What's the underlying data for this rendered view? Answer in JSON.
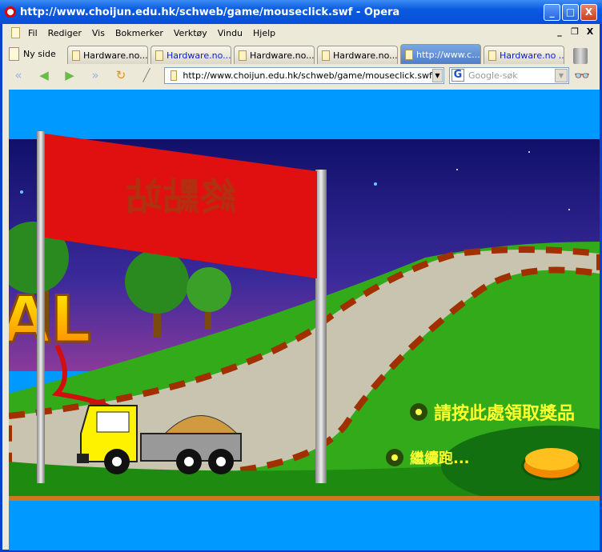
{
  "window": {
    "title": "http://www.choijun.edu.hk/schweb/game/mouseclick.swf - Opera",
    "minimize": "_",
    "maximize": "□",
    "close": "X"
  },
  "menu": [
    "Fil",
    "Rediger",
    "Vis",
    "Bokmerker",
    "Verktøy",
    "Vindu",
    "Hjelp"
  ],
  "mdi": {
    "minimize": "_",
    "restore": "❐",
    "close": "X"
  },
  "tabs": {
    "new_tab": "Ny side",
    "items": [
      {
        "label": "Hardware.no...",
        "blue": false
      },
      {
        "label": "Hardware.no...",
        "blue": true
      },
      {
        "label": "Hardware.no...",
        "blue": false
      },
      {
        "label": "Hardware.no...",
        "blue": false
      },
      {
        "label": "http://www.c...",
        "active": true
      },
      {
        "label": "Hardware.no ...",
        "blue": true
      }
    ]
  },
  "toolbar": {
    "address": "http://www.choijun.edu.hk/schweb/game/mouseclick.swf",
    "search_placeholder": "Google-søk",
    "search_engine": "G"
  },
  "game": {
    "banner_text": "終點站",
    "goal_text": "AL",
    "claim_prize": "請按此處領取獎品",
    "continue_run": "繼續跑..."
  }
}
